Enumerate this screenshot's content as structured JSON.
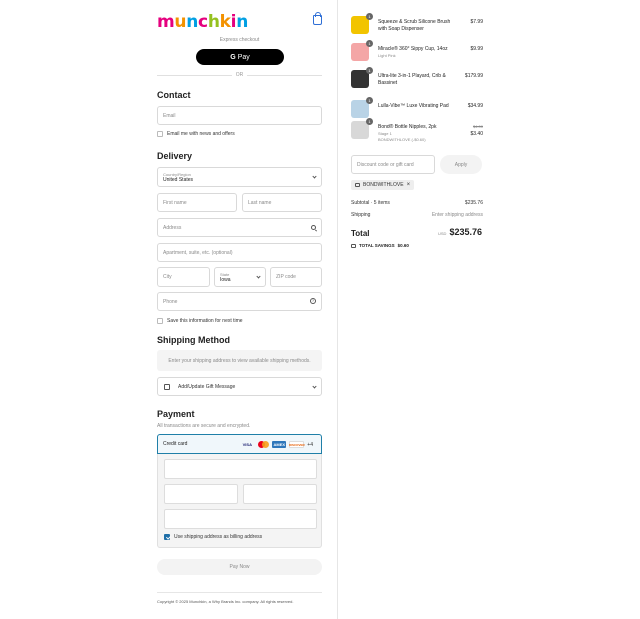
{
  "brand": {
    "letters": [
      "m",
      "u",
      "n",
      "c",
      "h",
      "k",
      "i",
      "n"
    ],
    "letter_colors": [
      "#e5007e",
      "#f39200",
      "#009fe3",
      "#e5007e",
      "#95c11f",
      "#f39200",
      "#e5007e",
      "#009fe3"
    ]
  },
  "express": {
    "label": "Express checkout",
    "gpay_label": "Pay",
    "gpay_g": "G",
    "or": "OR"
  },
  "contact": {
    "heading": "Contact",
    "email_placeholder": "Email",
    "news_label": "Email me with news and offers"
  },
  "delivery": {
    "heading": "Delivery",
    "country_label": "Country/Region",
    "country_value": "United States",
    "first_name": "First name",
    "last_name": "Last name",
    "address": "Address",
    "apartment": "Apartment, suite, etc. (optional)",
    "city": "City",
    "state_label": "State",
    "state_value": "Iowa",
    "zip": "ZIP code",
    "phone": "Phone",
    "save_info": "Save this information for next time"
  },
  "shipping": {
    "heading": "Shipping Method",
    "notice": "Enter your shipping address to view available shipping methods.",
    "gift": "Add/Update Gift Message"
  },
  "payment": {
    "heading": "Payment",
    "secure": "All transactions are secure and encrypted.",
    "method": "Credit card",
    "cards": [
      "VISA",
      "MC",
      "AMEX",
      "DISCOVER"
    ],
    "more": "+4",
    "billing_same": "Use shipping address as billing address",
    "pay_now": "Pay Now"
  },
  "footer": {
    "copyright": "Copyright © 2025 Munchkin, a Why Brands Inc. company. All rights reserved."
  },
  "cart": {
    "items": [
      {
        "qty": "1",
        "name": "Squeeze & Scrub Silicone Brush with Soap Dispenser",
        "variant": "",
        "price": "$7.99",
        "old_price": "",
        "discount": "",
        "thumb_color": "#f2c400"
      },
      {
        "qty": "1",
        "name": "Miracle® 360° Sippy Cup, 14oz",
        "variant": "Light Pink",
        "price": "$9.99",
        "old_price": "",
        "discount": "",
        "thumb_color": "#f4a6a6"
      },
      {
        "qty": "1",
        "name": "Ultra-lite 3-in-1 Playard, Crib & Bassinet",
        "variant": "",
        "price": "$179.99",
        "old_price": "",
        "discount": "",
        "thumb_color": "#333333"
      },
      {
        "qty": "1",
        "name": "Lulla-Vibe™ Luxe Vibrating Pad",
        "variant": "",
        "price": "$34.99",
        "old_price": "",
        "discount": "",
        "thumb_color": "#b9d3e6"
      },
      {
        "qty": "1",
        "name": "Bond® Bottle Nipples, 2pk",
        "variant": "Stage 1",
        "price": "$3.40",
        "old_price": "$4.00",
        "discount": "BONDWITHLOVE (-$0.60)",
        "thumb_color": "#d8d8d8"
      }
    ],
    "discount_placeholder": "Discount code or gift card",
    "apply_label": "Apply",
    "applied_code": "BONDWITHLOVE",
    "subtotal_label": "Subtotal · 5 items",
    "subtotal_value": "$235.76",
    "shipping_label": "Shipping",
    "shipping_value": "Enter shipping address",
    "total_label": "Total",
    "currency": "USD",
    "total_value": "$235.76",
    "savings_label": "TOTAL SAVINGS",
    "savings_value": "$0.60"
  }
}
